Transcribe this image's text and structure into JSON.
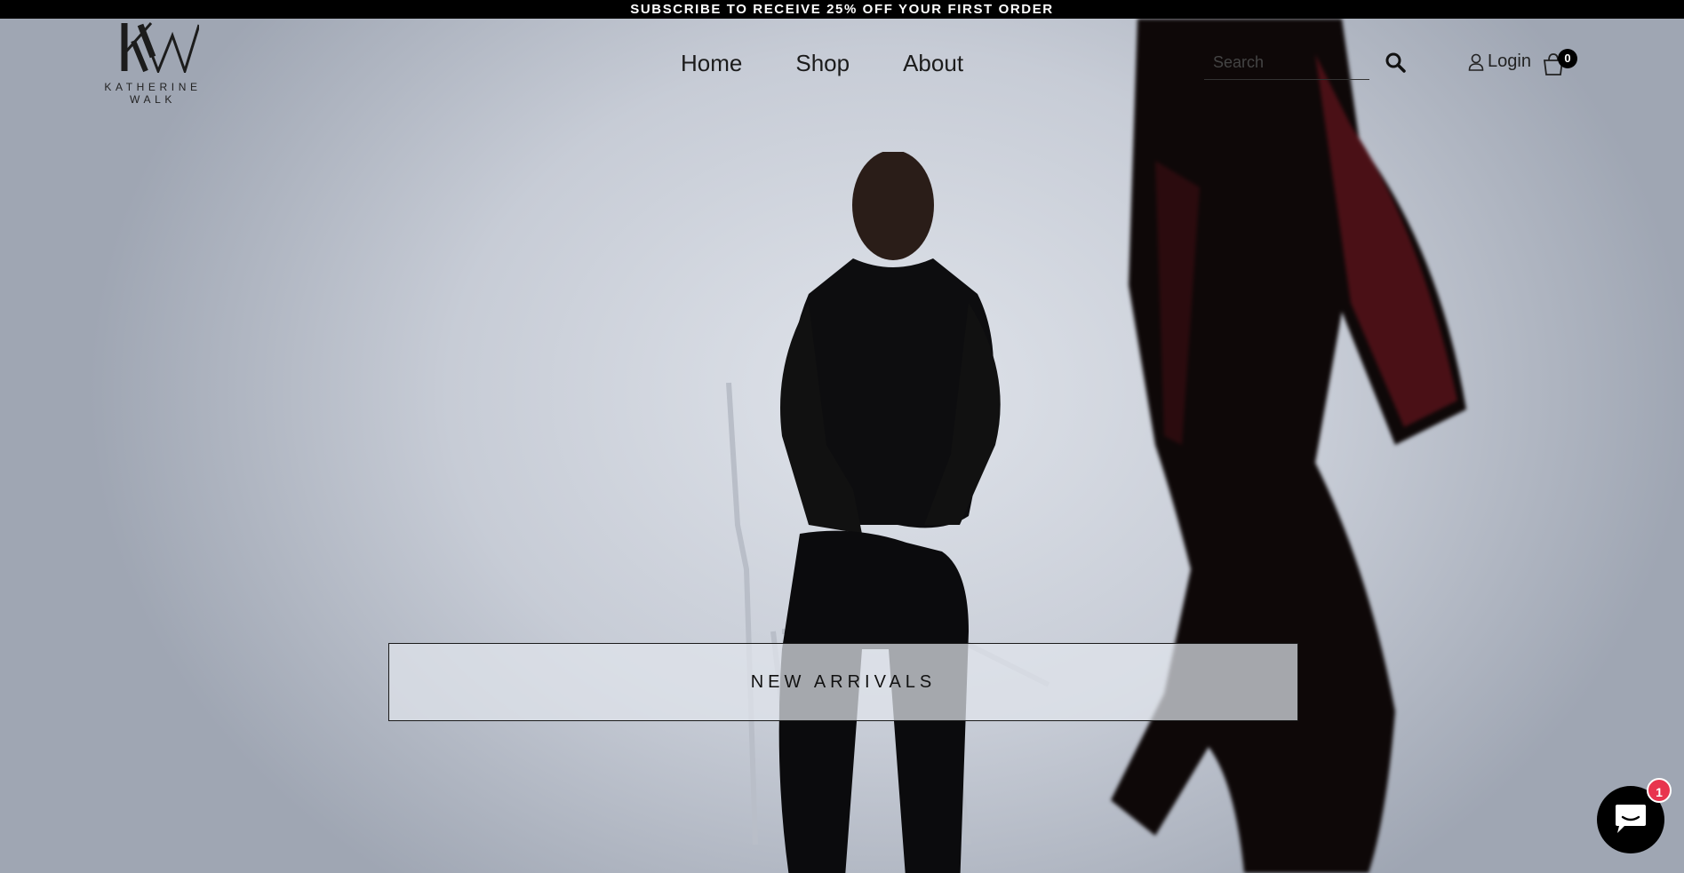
{
  "announcement": {
    "text": "SUBSCRIBE TO RECEIVE 25% OFF YOUR FIRST ORDER"
  },
  "brand": {
    "wordmark": "KATHERINE WALK",
    "monogram": "KW"
  },
  "nav": {
    "items": [
      {
        "label": "Home"
      },
      {
        "label": "Shop"
      },
      {
        "label": "About"
      }
    ]
  },
  "search": {
    "placeholder": "Search",
    "value": ""
  },
  "account": {
    "login_label": "Login"
  },
  "cart": {
    "count": "0"
  },
  "hero": {
    "cta_label": "NEW ARRIVALS"
  },
  "chat": {
    "badge_count": "1"
  },
  "icons": {
    "search": "search-icon",
    "user": "user-icon",
    "cart": "shopping-bag-icon",
    "chat": "chat-bubble-icon"
  },
  "colors": {
    "announcement_bg": "#000000",
    "chat_badge": "#e8344e",
    "cart_badge": "#000000"
  }
}
